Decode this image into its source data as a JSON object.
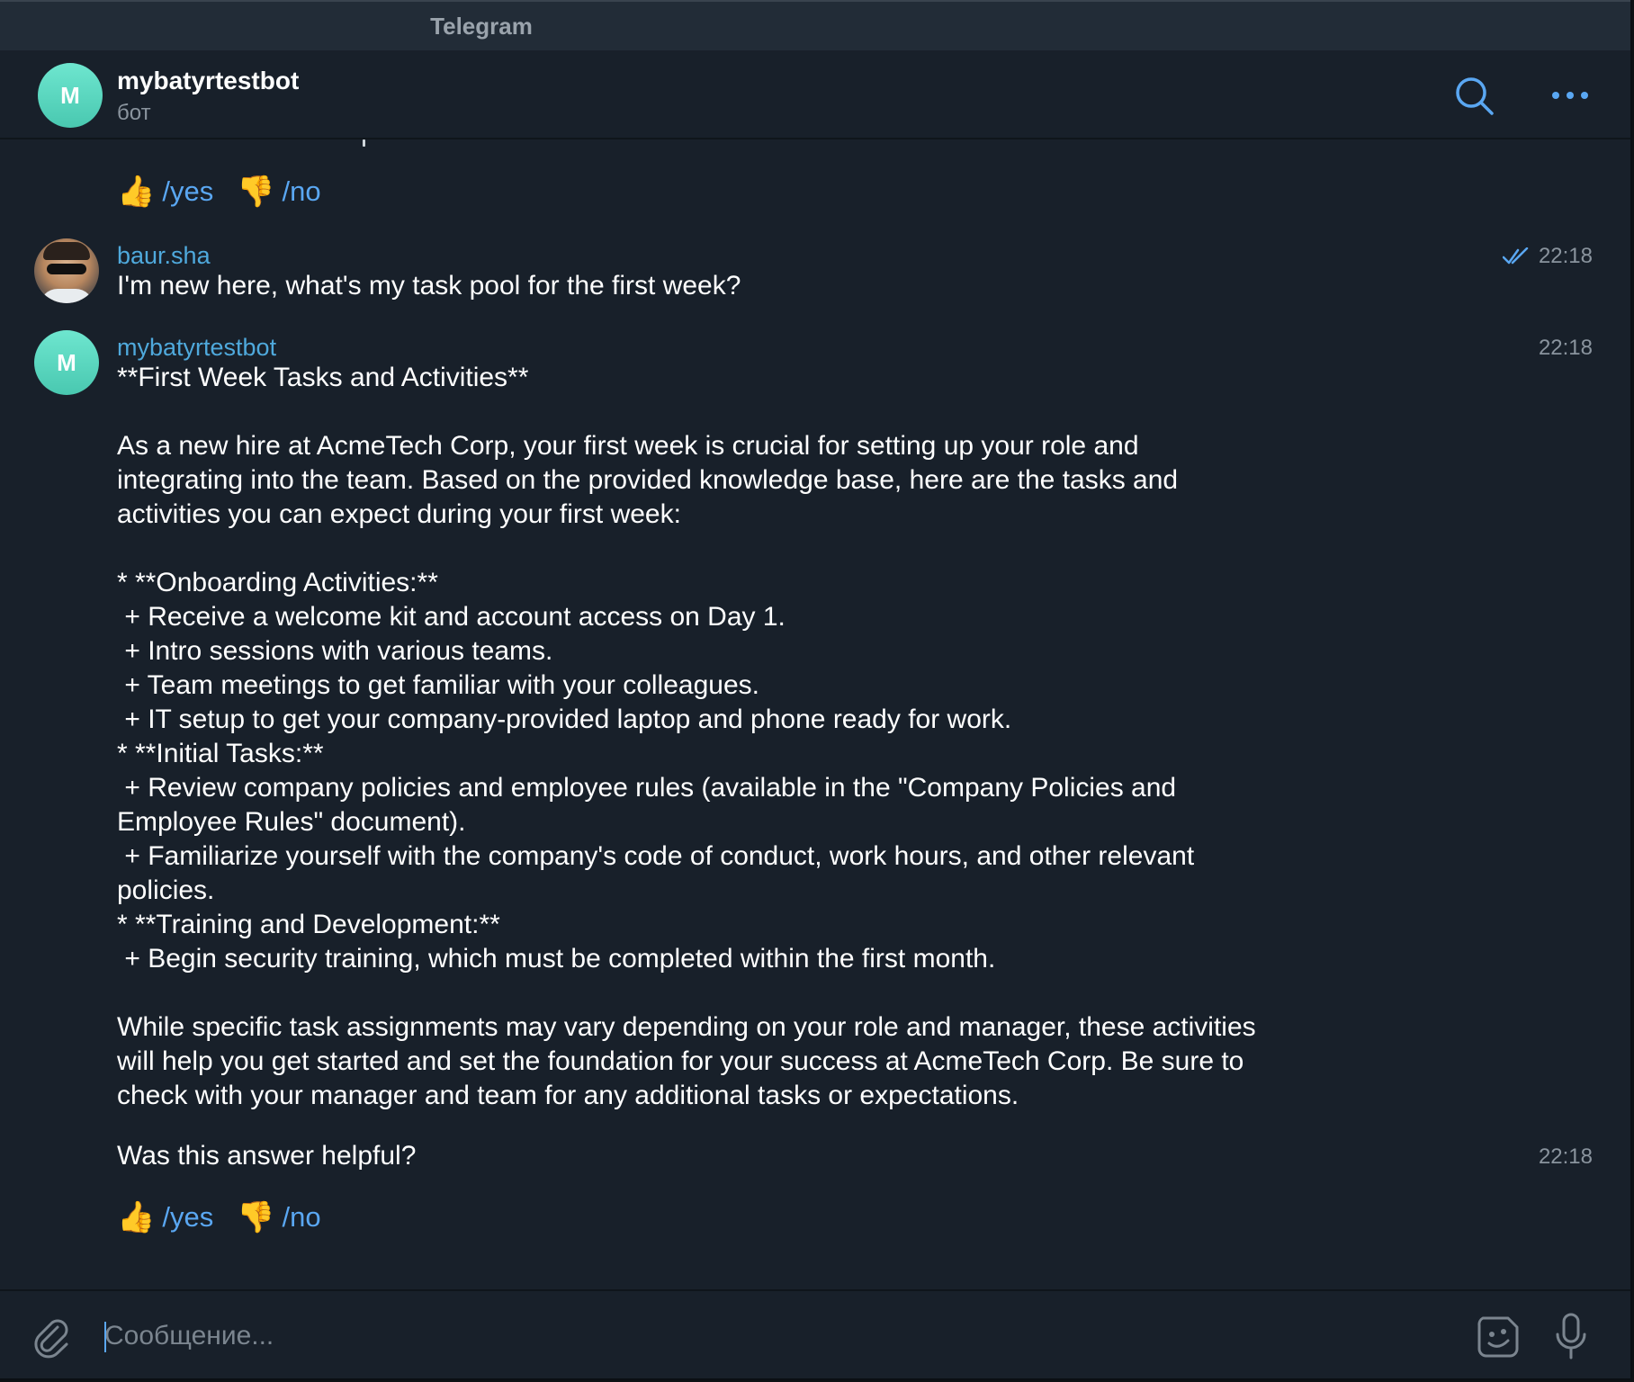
{
  "app": {
    "window_title": "Telegram"
  },
  "header": {
    "avatar_letter": "M",
    "name": "mybatyrtestbot",
    "status": "бот",
    "icons": [
      "search-icon",
      "more-icon"
    ]
  },
  "messages": {
    "prev_feedback": {
      "yes_emoji": "👍",
      "yes_cmd": "/yes",
      "no_emoji": "👎",
      "no_cmd": "/no"
    },
    "user_msg": {
      "sender": "baur.sha",
      "time": "22:18",
      "read_icon": "double-check-icon",
      "text": "I'm new here, what's my task pool for the first week?"
    },
    "bot_msg": {
      "avatar_letter": "M",
      "sender": "mybatyrtestbot",
      "time": "22:18",
      "text": "**First Week Tasks and Activities**\n\nAs a new hire at AcmeTech Corp, your first week is crucial for setting up your role and\nintegrating into the team. Based on the provided knowledge base, here are the tasks and\nactivities you can expect during your first week:\n\n* **Onboarding Activities:**\n + Receive a welcome kit and account access on Day 1.\n + Intro sessions with various teams.\n + Team meetings to get familiar with your colleagues.\n + IT setup to get your company-provided laptop and phone ready for work.\n* **Initial Tasks:**\n + Review company policies and employee rules (available in the \"Company Policies and\nEmployee Rules\" document).\n + Familiarize yourself with the company's code of conduct, work hours, and other relevant\npolicies.\n* **Training and Development:**\n + Begin security training, which must be completed within the first month.\n\nWhile specific task assignments may vary depending on your role and manager, these activities\nwill help you get started and set the foundation for your success at AcmeTech Corp. Be sure to\ncheck with your manager and team for any additional tasks or expectations."
    },
    "helpful_msg": {
      "text": "Was this answer helpful?",
      "time": "22:18"
    },
    "feedback": {
      "yes_emoji": "👍",
      "yes_cmd": "/yes",
      "no_emoji": "👎",
      "no_cmd": "/no"
    }
  },
  "composer": {
    "placeholder": "Сообщение...",
    "icons": [
      "paperclip-icon",
      "sticker-icon",
      "microphone-icon"
    ]
  },
  "colors": {
    "background": "#18202a",
    "accent": "#5aa7f2",
    "sender_name": "#4fa9dc",
    "muted": "#8a949e",
    "bot_avatar": "#5fd9c0"
  }
}
